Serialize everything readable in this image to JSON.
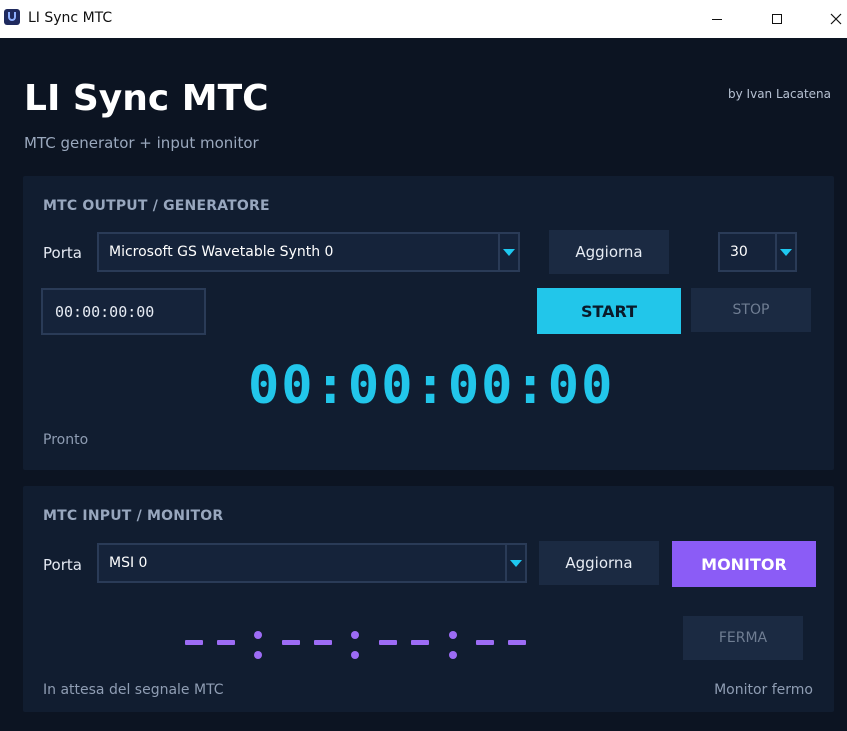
{
  "window": {
    "title": "LI Sync MTC",
    "minimize_icon": "minimize-icon",
    "maximize_icon": "maximize-icon",
    "close_icon": "close-icon"
  },
  "header": {
    "title": "LI Sync MTC",
    "subtitle": "MTC generator + input monitor",
    "author": "by Ivan Lacatena"
  },
  "output": {
    "section_title": "MTC OUTPUT / GENERATORE",
    "port_label": "Porta",
    "port_value": "Microsoft GS Wavetable Synth 0",
    "refresh_label": "Aggiorna",
    "fps_value": "30",
    "timecode_input": "00:00:00:00",
    "start_label": "START",
    "stop_label": "STOP",
    "timecode_display": "00:00:00:00",
    "status": "Pronto"
  },
  "input": {
    "section_title": "MTC INPUT / MONITOR",
    "port_label": "Porta",
    "port_value": "MSI 0",
    "refresh_label": "Aggiorna",
    "monitor_label": "MONITOR",
    "stop_label": "FERMA",
    "status_left": "In attesa del segnale MTC",
    "status_right": "Monitor fermo"
  },
  "colors": {
    "accent_cyan": "#22c6ea",
    "accent_purple": "#8b5cf6",
    "background": "#0c1422",
    "panel": "#111d30"
  }
}
